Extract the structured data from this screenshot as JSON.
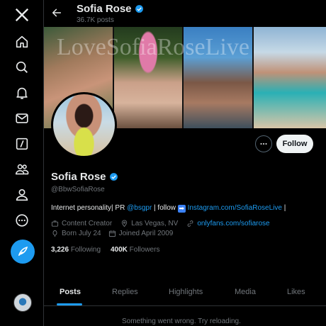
{
  "header": {
    "display_name": "Sofia Rose",
    "post_count": "36.7K posts"
  },
  "banner": {
    "watermark": "LoveSofiaRoseLive"
  },
  "actions": {
    "follow_label": "Follow"
  },
  "profile": {
    "name": "Sofia Rose",
    "handle": "@BbwSofiaRose",
    "bio_prefix": "Internet personality| PR ",
    "bio_mention": "@bsgpr",
    "bio_middle": " | follow ",
    "bio_arrow": "➡",
    "bio_link": "Instagram.com/SofiaRoseLive",
    "bio_suffix": " |",
    "category": "Content Creator",
    "location": "Las Vegas, NV",
    "website": "onlyfans.com/sofiarose",
    "birthday": "Born July 24",
    "joined": "Joined April 2009",
    "following_count": "3,226",
    "following_label": "Following",
    "followers_count": "400K",
    "followers_label": "Followers"
  },
  "tabs": [
    "Posts",
    "Replies",
    "Highlights",
    "Media",
    "Likes"
  ],
  "message": "Something went wrong. Try reloading.",
  "colors": {
    "accent": "#1d9bf0",
    "background": "#000000",
    "muted_text": "#71767b"
  },
  "icons": {
    "rail": [
      "x-logo-icon",
      "home-icon",
      "search-icon",
      "bell-icon",
      "mail-icon",
      "grok-icon",
      "communities-icon",
      "profile-icon",
      "more-icon",
      "compose-icon"
    ]
  }
}
